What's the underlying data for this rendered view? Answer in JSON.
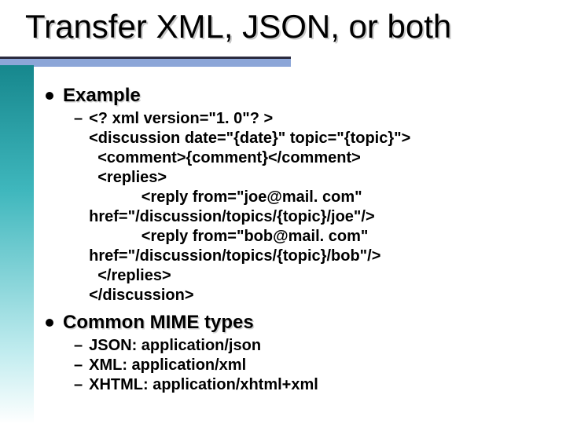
{
  "title": "Transfer XML, JSON, or both",
  "sections": {
    "example": {
      "heading": "Example",
      "xml": "<? xml version=\"1. 0\"? >\n<discussion date=\"{date}\" topic=\"{topic}\">\n  <comment>{comment}</comment>\n  <replies>\n            <reply from=\"joe@mail. com\"\nhref=\"/discussion/topics/{topic}/joe\"/>\n            <reply from=\"bob@mail. com\"\nhref=\"/discussion/topics/{topic}/bob\"/>\n  </replies>\n</discussion>"
    },
    "mime": {
      "heading": "Common MIME types",
      "items": [
        "JSON: application/json",
        "XML: application/xml",
        "XHTML: application/xhtml+xml"
      ]
    }
  }
}
